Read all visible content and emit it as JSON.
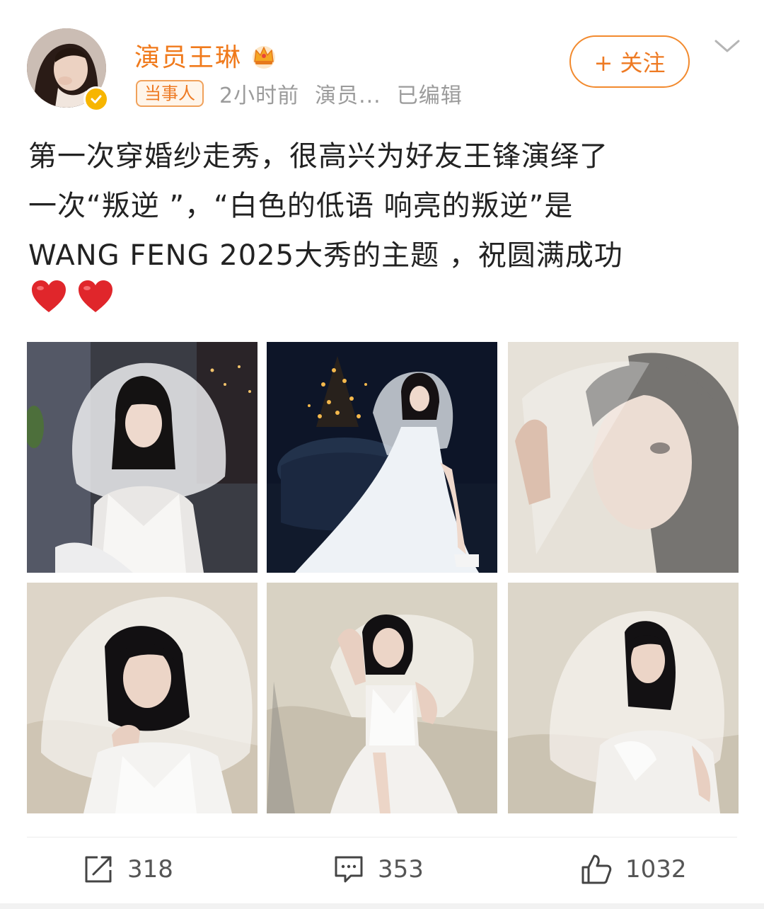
{
  "user": {
    "name": "演员王琳",
    "tag": "当事人",
    "time": "2小时前",
    "role": "演员...",
    "edited": "已编辑",
    "follow_label": "+ 关注"
  },
  "post": {
    "lines": [
      "第一次穿婚纱走秀，很高兴为好友王锋演绎了",
      "一次“叛逆 ”，“白色的低语 响亮的叛逆”是",
      " WANG FENG 2025大秀的主题 ，祝圆满成功"
    ]
  },
  "actions": {
    "repost_count": "318",
    "comment_count": "353",
    "like_count": "1032"
  },
  "colors": {
    "accent_orange": "#ee7a23",
    "verified_yellow": "#f7b500",
    "heart_red": "#e0262b"
  },
  "icons": [
    "crown-icon",
    "verified-icon",
    "chevron-down-icon",
    "heart-icon",
    "repost-icon",
    "comment-icon",
    "like-icon"
  ]
}
